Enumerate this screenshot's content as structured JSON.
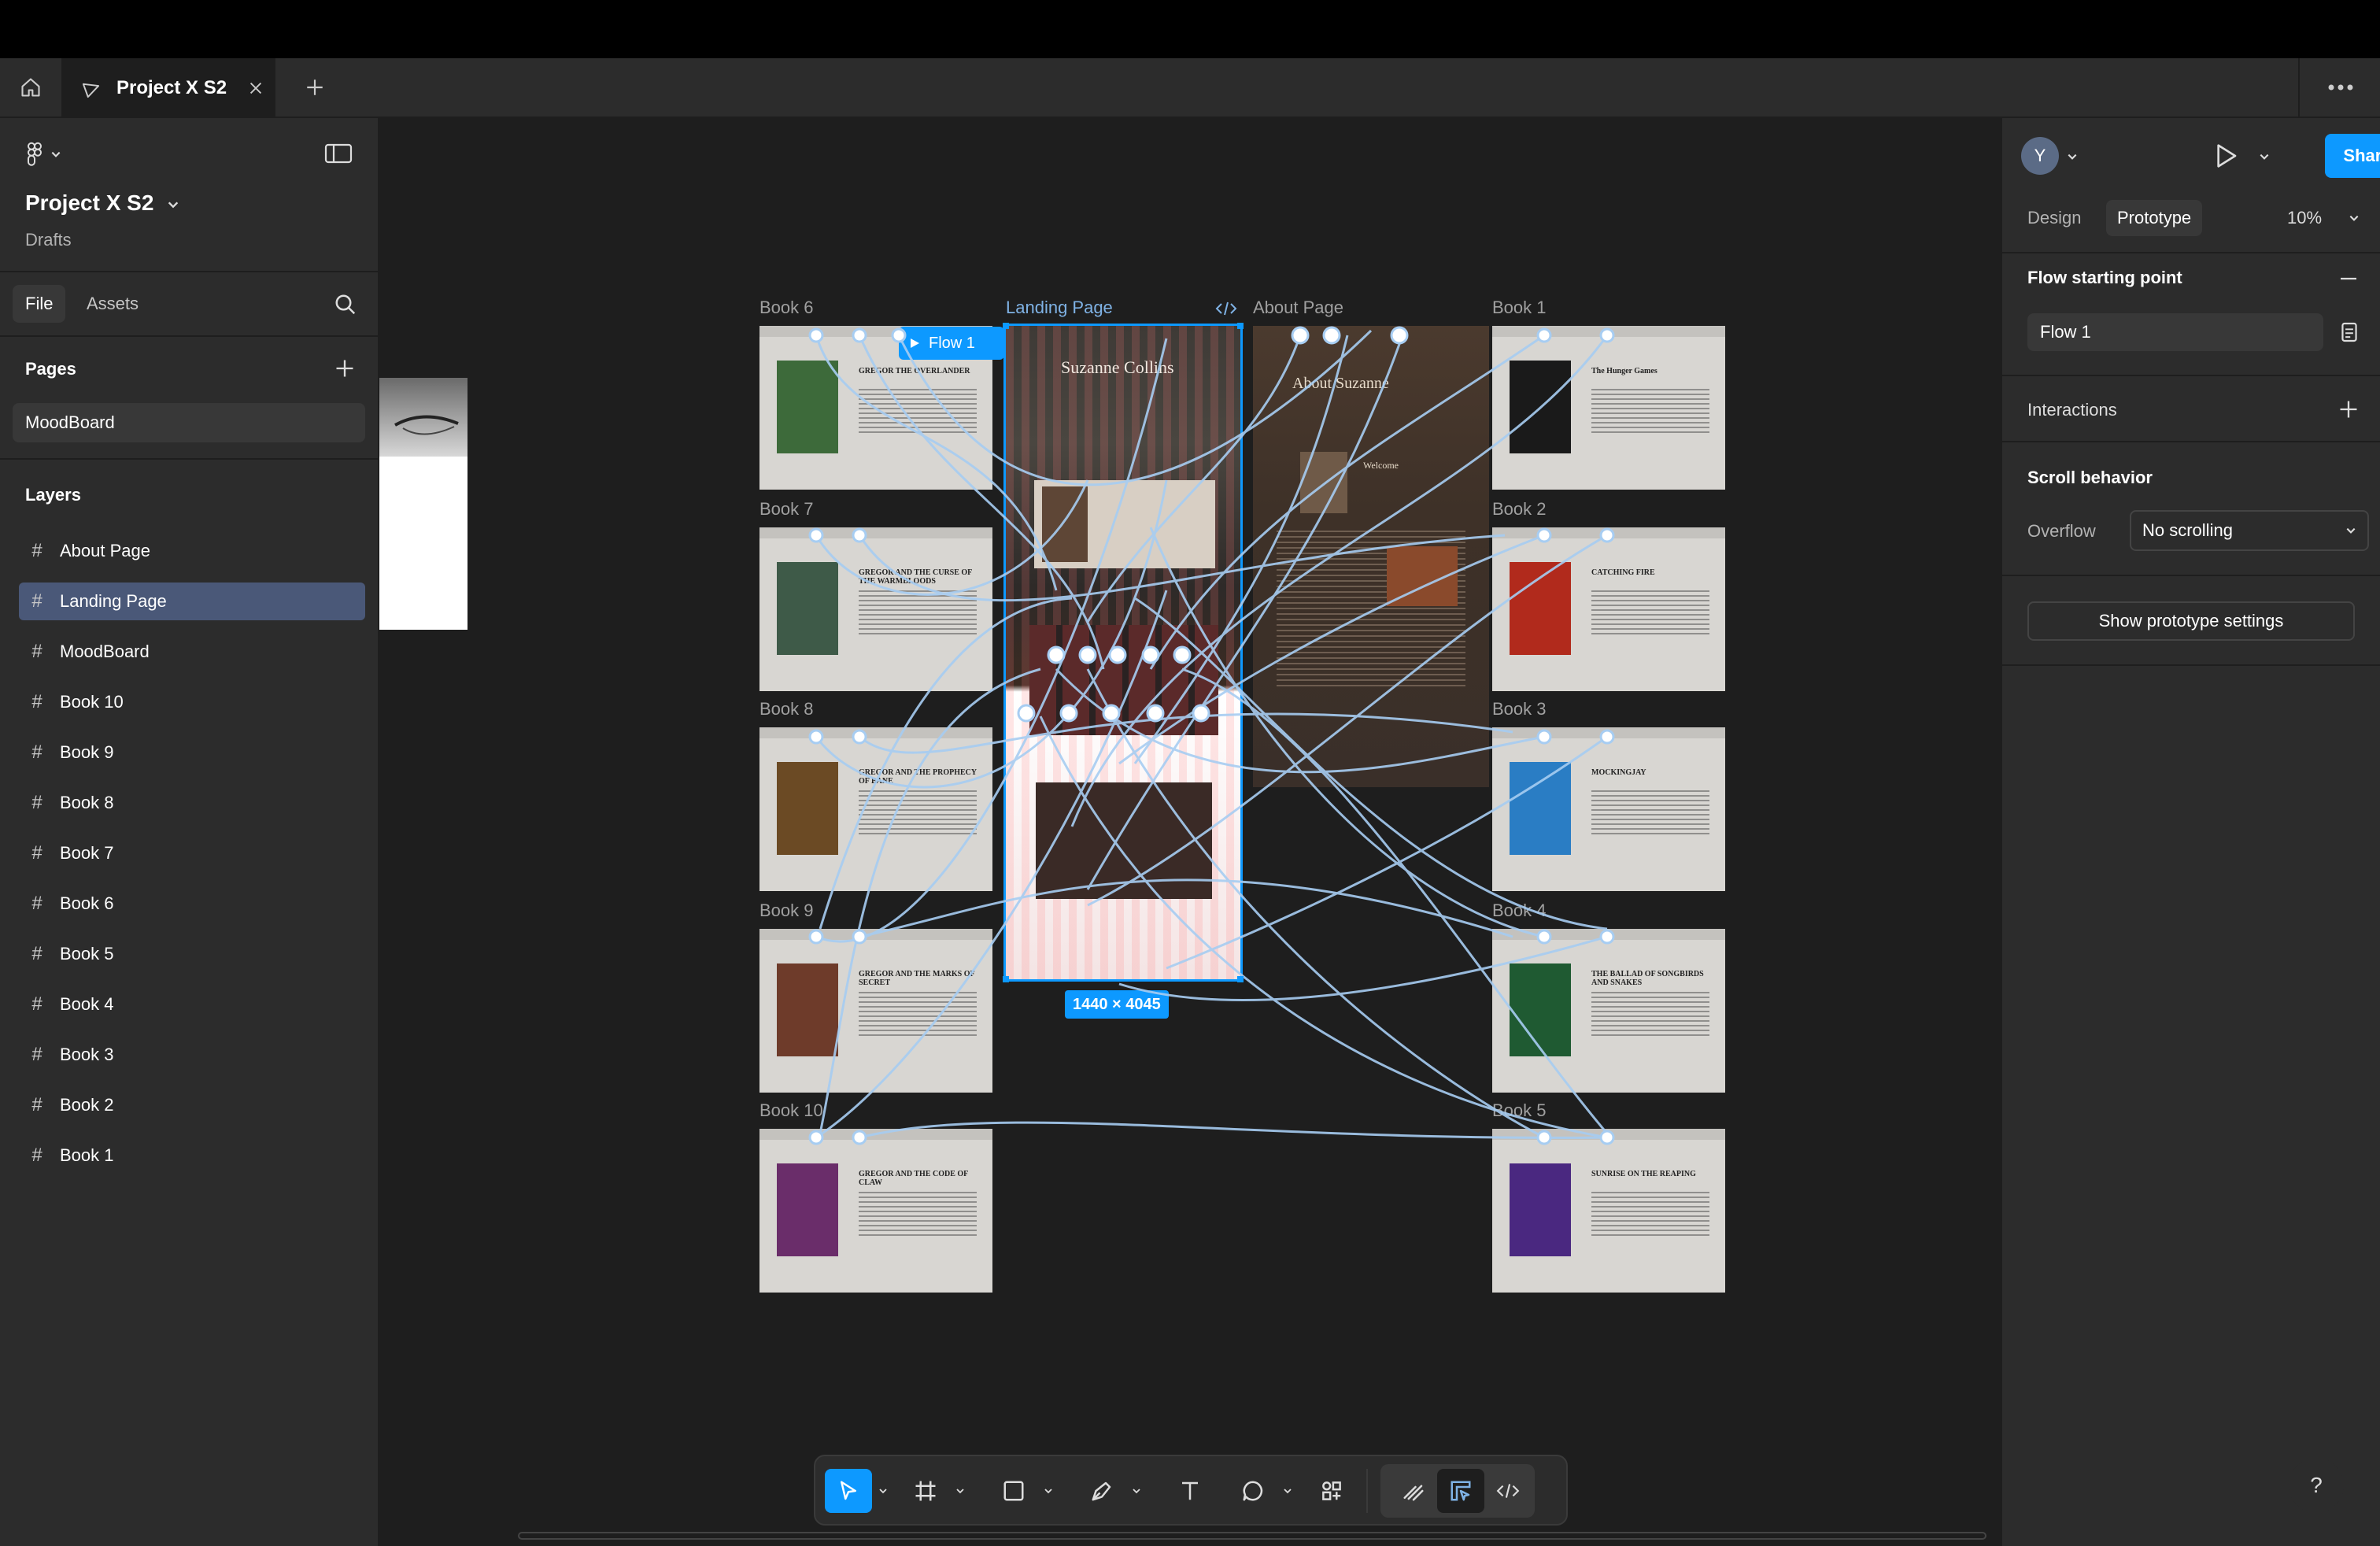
{
  "tabs": {
    "active_title": "Project X S2"
  },
  "file": {
    "name": "Project X S2",
    "location": "Drafts"
  },
  "left_tabs": {
    "file": "File",
    "assets": "Assets"
  },
  "pages": {
    "title": "Pages",
    "items": [
      "MoodBoard"
    ]
  },
  "layers": {
    "title": "Layers",
    "items": [
      "About Page",
      "Landing Page",
      "MoodBoard",
      "Book 10",
      "Book 9",
      "Book 8",
      "Book 7",
      "Book 6",
      "Book 5",
      "Book 4",
      "Book 3",
      "Book 2",
      "Book 1"
    ],
    "selected": "Landing Page"
  },
  "right_panel": {
    "avatar_initial": "Y",
    "share": "Share",
    "tabs": {
      "design": "Design",
      "prototype": "Prototype"
    },
    "zoom": "10%",
    "flow_section": "Flow starting point",
    "flow_name": "Flow 1",
    "interactions": "Interactions",
    "scroll_behavior": "Scroll behavior",
    "overflow_label": "Overflow",
    "overflow_value": "No scrolling",
    "prototype_settings": "Show prototype settings"
  },
  "canvas": {
    "landing_label": "Landing Page",
    "about_label": "About Page",
    "flow_badge": "Flow 1",
    "dimensions": "1440 × 4045",
    "landing_title": "Suzanne Collins",
    "about_title": "About Suzanne",
    "about_welcome": "Welcome",
    "books": [
      {
        "label": "Book 6",
        "title": "GREGOR THE OVERLANDER",
        "cover": "#3d6a3a"
      },
      {
        "label": "Book 7",
        "title": "GREGOR AND THE CURSE OF THE WARMBLOODS",
        "cover": "#3e5a48"
      },
      {
        "label": "Book 8",
        "title": "GREGOR AND THE PROPHECY OF BANE",
        "cover": "#6b4a24"
      },
      {
        "label": "Book 9",
        "title": "GREGOR AND THE MARKS OF SECRET",
        "cover": "#6e3b2a"
      },
      {
        "label": "Book 10",
        "title": "GREGOR AND THE CODE OF CLAW",
        "cover": "#6a2d6a"
      },
      {
        "label": "Book 1",
        "title": "The Hunger Games",
        "cover": "#1a1a1a"
      },
      {
        "label": "Book 2",
        "title": "CATCHING FIRE",
        "cover": "#b12a1c"
      },
      {
        "label": "Book 3",
        "title": "MOCKINGJAY",
        "cover": "#2a7dc4"
      },
      {
        "label": "Book 4",
        "title": "THE BALLAD OF SONGBIRDS AND SNAKES",
        "cover": "#1f5a32"
      },
      {
        "label": "Book 5",
        "title": "SUNRISE ON THE REAPING",
        "cover": "#4a2880"
      }
    ]
  },
  "colors": {
    "accent": "#0d99ff",
    "connector": "#a7cdf2",
    "selection": "#4a5878"
  }
}
